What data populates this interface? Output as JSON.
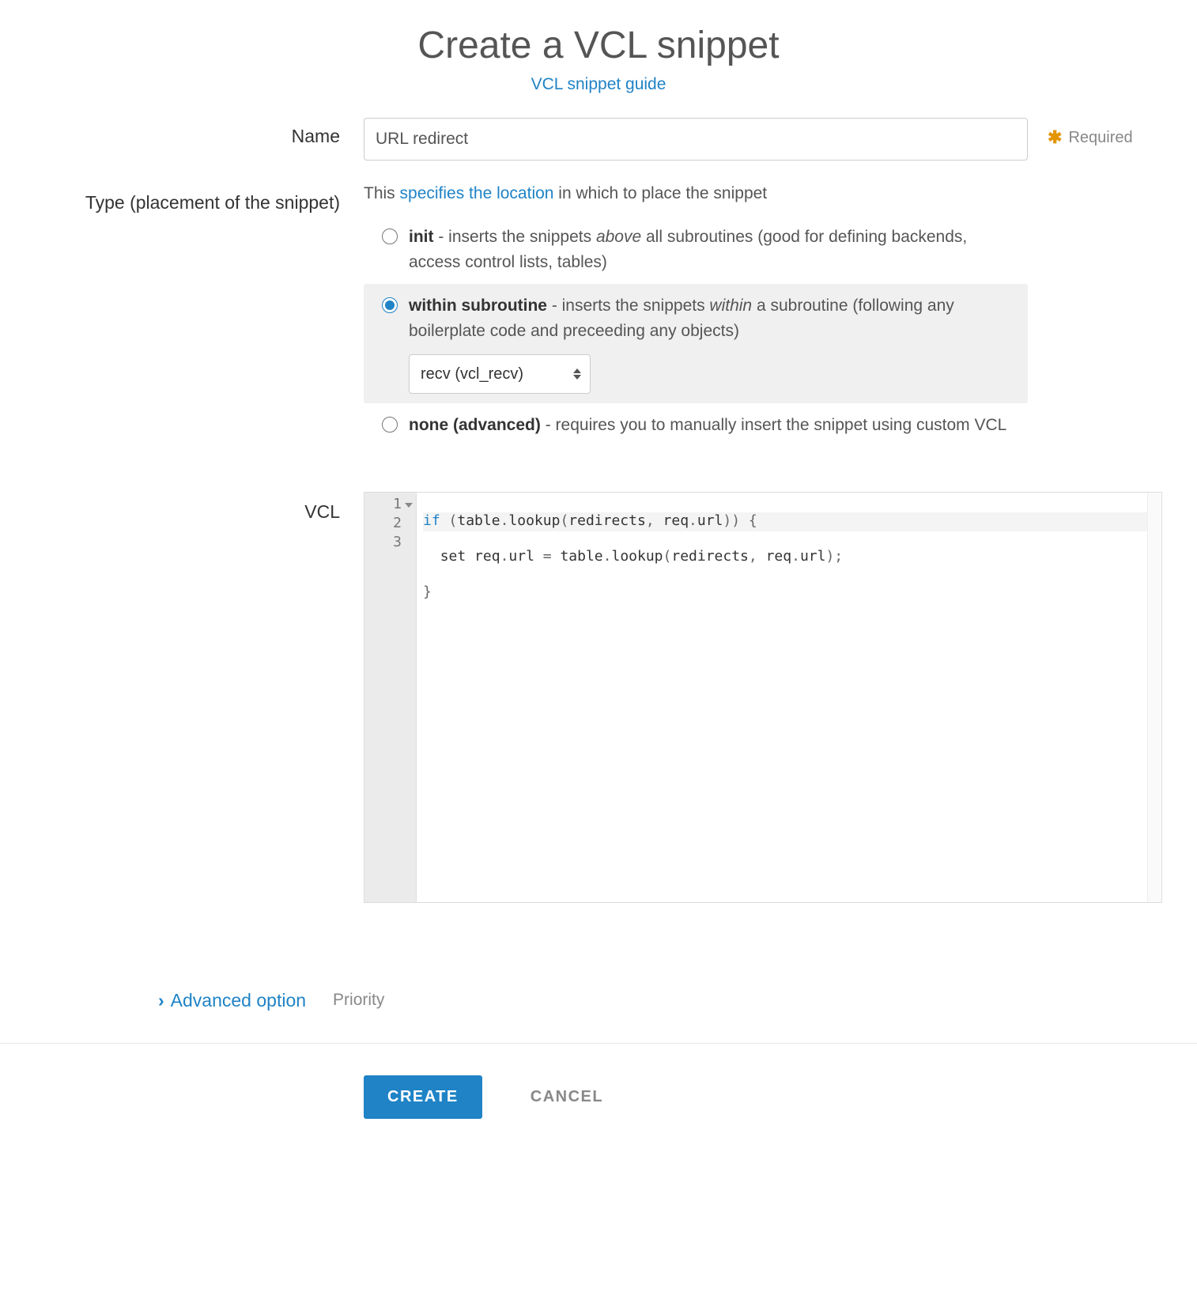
{
  "title": "Create a VCL snippet",
  "guide_link": "VCL snippet guide",
  "name": {
    "label": "Name",
    "value": "URL redirect",
    "required_text": "Required"
  },
  "type": {
    "label": "Type (placement of the snippet)",
    "intro_prefix": "This ",
    "intro_link": "specifies the location",
    "intro_suffix": " in which to place the snippet",
    "options": {
      "init": {
        "bold": "init",
        "after_bold": " - inserts the snippets ",
        "italic": "above",
        "rest": " all subroutines (good for defining backends, access control lists, tables)"
      },
      "within": {
        "bold": "within subroutine",
        "after_bold": " - inserts the snippets ",
        "italic": "within",
        "rest": " a subroutine (following any boilerplate code and preceeding any objects)",
        "select_value": "recv (vcl_recv)"
      },
      "none": {
        "bold": "none (advanced)",
        "rest": " - requires you to manually insert the snippet using custom VCL"
      }
    },
    "selected": "within"
  },
  "vcl": {
    "label": "VCL",
    "lines": [
      "if (table.lookup(redirects, req.url)) {",
      "  set req.url = table.lookup(redirects, req.url);",
      "}"
    ]
  },
  "advanced": {
    "toggle_label": "Advanced option",
    "sub_label": "Priority"
  },
  "buttons": {
    "create": "CREATE",
    "cancel": "CANCEL"
  }
}
